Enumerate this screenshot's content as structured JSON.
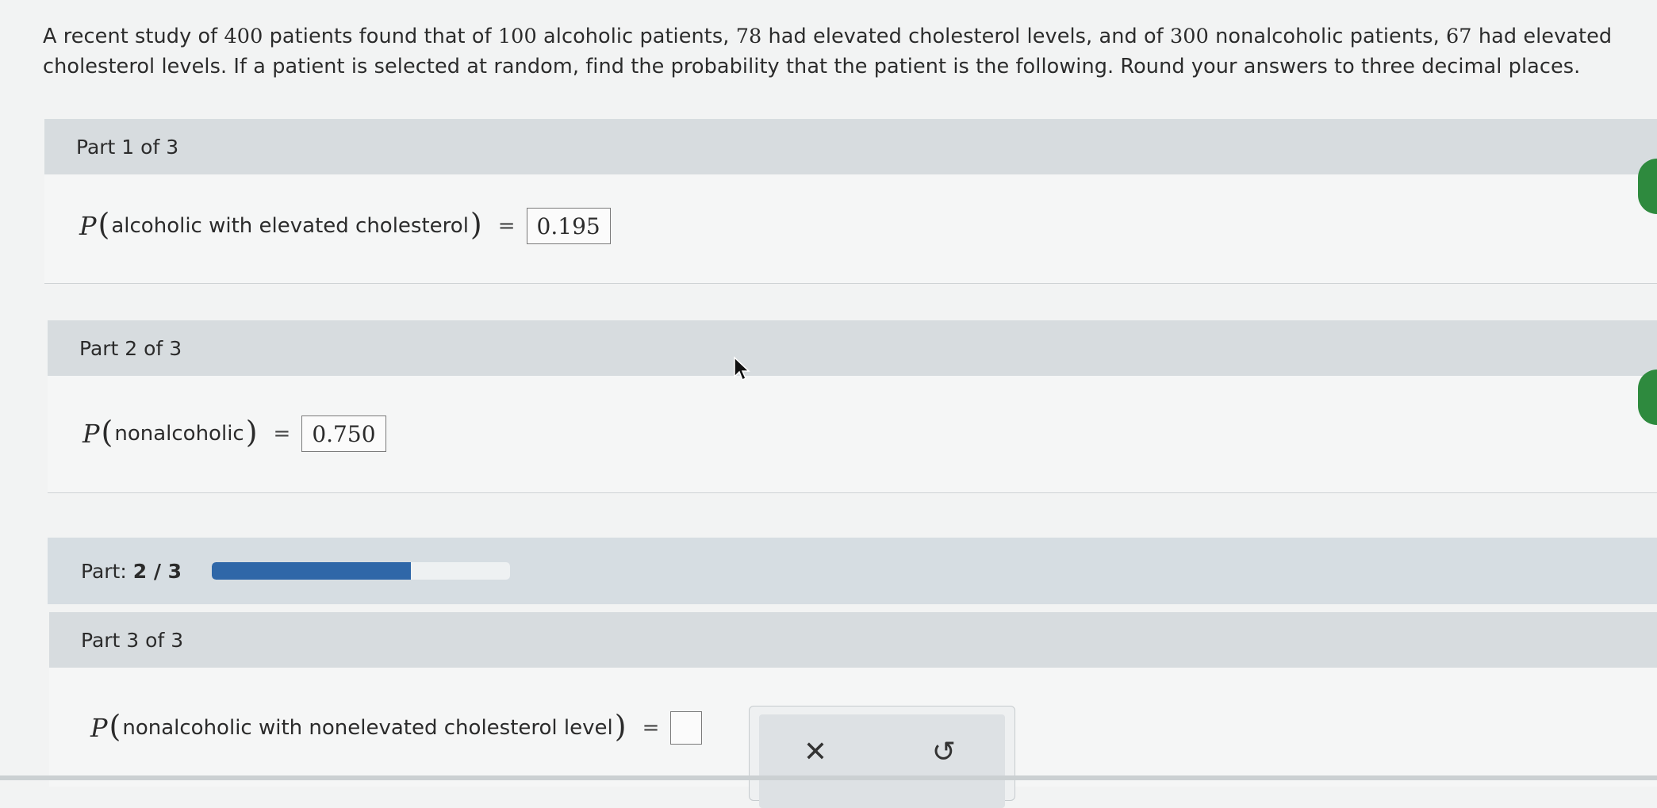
{
  "problem": {
    "line1_a": "A recent study of ",
    "n_total": "400",
    "line1_b": " patients found that of ",
    "n_alc": "100",
    "line1_c": " alcoholic patients, ",
    "n_alc_elev": "78",
    "line1_d": " had elevated cholesterol levels, and of ",
    "n_nonalc": "300",
    "line1_e": " nonalcoholic patients, ",
    "n_nonalc_elev": "67",
    "line1_f": " had elevated",
    "line2": "cholesterol levels. If a patient is selected at random, find the probability that the patient is the following. Round your answers to three decimal places."
  },
  "parts": [
    {
      "header": "Part 1 of 3",
      "p_letter": "P",
      "event": "alcoholic with elevated cholesterol",
      "equals": "=",
      "answer": "0.195",
      "status": "correct"
    },
    {
      "header": "Part 2 of 3",
      "p_letter": "P",
      "event": "nonalcoholic",
      "equals": "=",
      "answer": "0.750",
      "status": "correct"
    },
    {
      "header": "Part 3 of 3",
      "p_letter": "P",
      "event": "nonalcoholic with nonelevated cholesterol level",
      "equals": "=",
      "answer": ""
    }
  ],
  "progress": {
    "label": "Part: ",
    "current_of_total": "2 / 3",
    "fraction": 0.667
  },
  "actions": {
    "clear_icon": "close-icon",
    "clear_glyph": "✕",
    "undo_icon": "undo-icon",
    "undo_glyph": "↺"
  },
  "colors": {
    "progress_fill": "#2f67a8",
    "correct_tab": "#2e8a3e",
    "header_bg": "#d7dcdf"
  }
}
